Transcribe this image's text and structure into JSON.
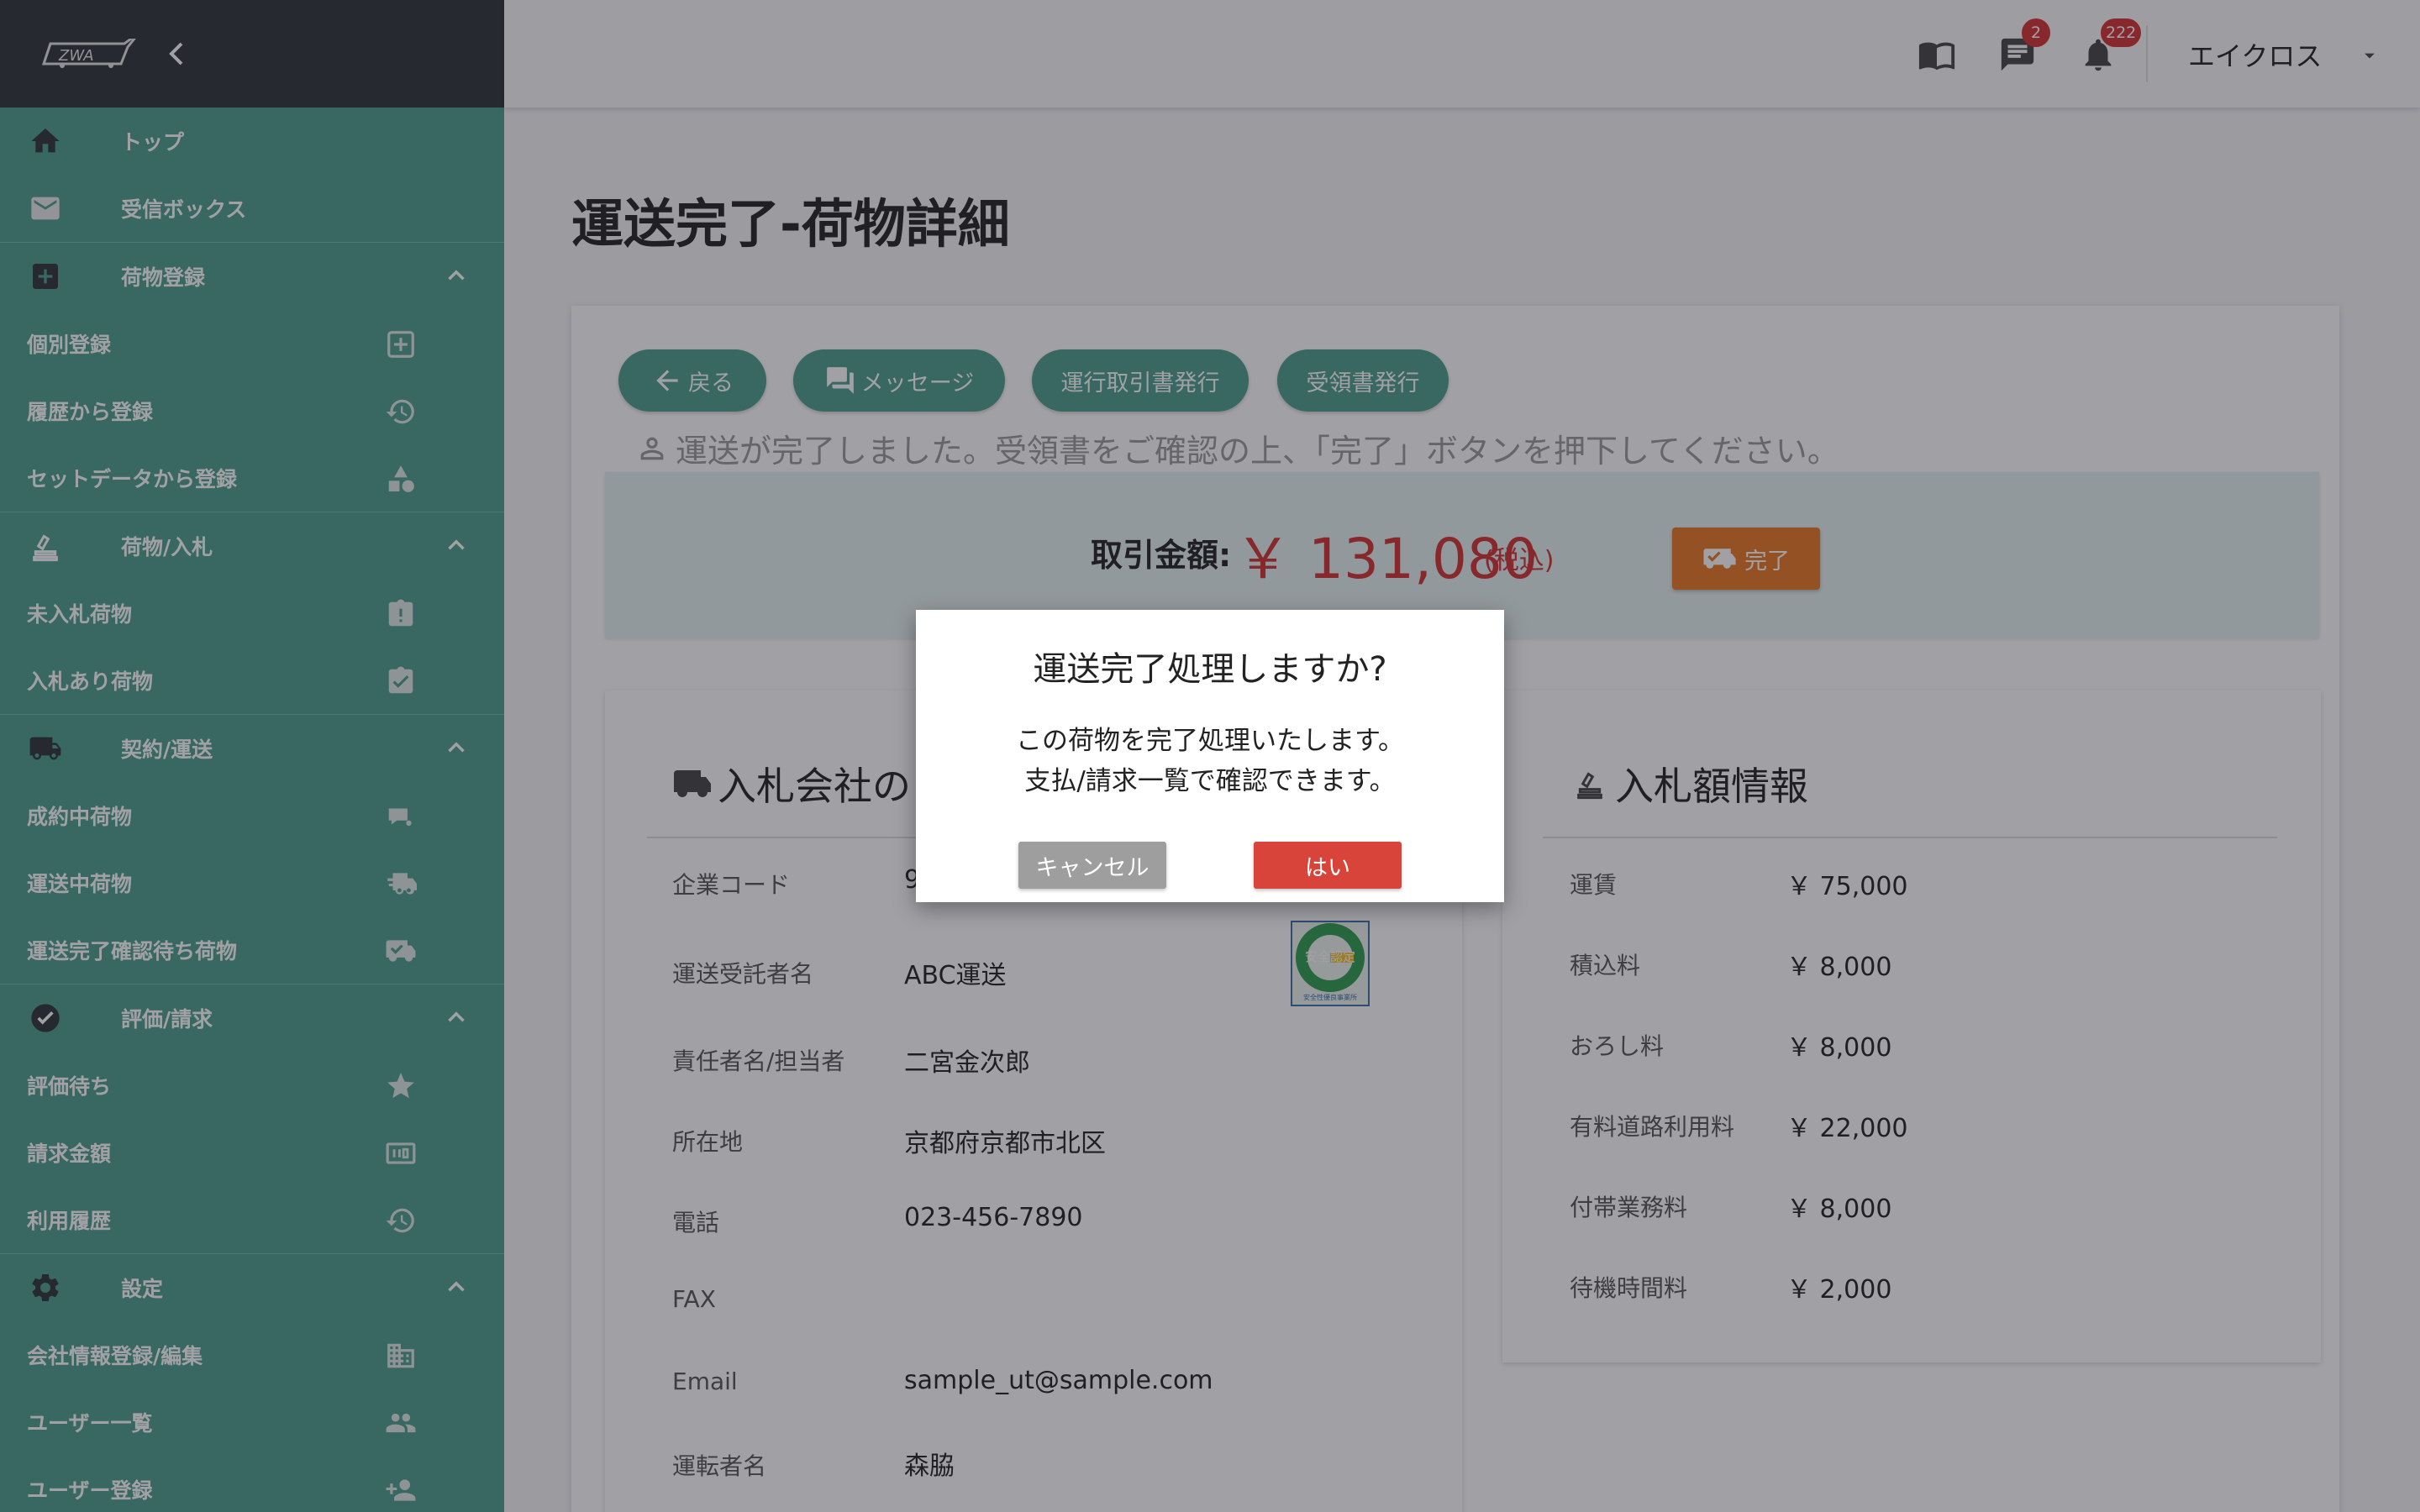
{
  "app": {
    "logo_icon": "truck-logo-icon"
  },
  "colors": {
    "sidebar": "#4a9e8a",
    "sidebar_header": "#2b3135",
    "accent": "#4a9e8a",
    "danger": "#d32f2f",
    "complete": "#e87722"
  },
  "sidebar": {
    "top": {
      "label": "トップ",
      "icon": "home-icon"
    },
    "inbox": {
      "label": "受信ボックス",
      "icon": "mail-icon"
    },
    "group1": {
      "label": "荷物登録",
      "icon": "plus-box-icon"
    },
    "reg_single": {
      "label": "個別登録",
      "icon": "add-box-icon"
    },
    "reg_history": {
      "label": "履歴から登録",
      "icon": "history-icon"
    },
    "reg_set": {
      "label": "セットデータから登録",
      "icon": "shapes-icon"
    },
    "group2": {
      "label": "荷物/入札",
      "icon": "bid-icon"
    },
    "unbid": {
      "label": "未入札荷物",
      "icon": "clipboard-alert-icon"
    },
    "bid": {
      "label": "入札あり荷物",
      "icon": "clipboard-check-icon"
    },
    "group3": {
      "label": "契約/運送",
      "icon": "truck-icon"
    },
    "contracted": {
      "label": "成約中荷物",
      "icon": "small-truck-icon"
    },
    "shipping": {
      "label": "運送中荷物",
      "icon": "truck-fast-icon"
    },
    "awaiting": {
      "label": "運送完了確認待ち荷物",
      "icon": "truck-check-icon"
    },
    "group4": {
      "label": "評価/請求",
      "icon": "check-circle-icon"
    },
    "rating": {
      "label": "評価待ち",
      "icon": "star-icon"
    },
    "billing": {
      "label": "請求金額",
      "icon": "counter-icon"
    },
    "usage": {
      "label": "利用履歴",
      "icon": "history-icon"
    },
    "group5": {
      "label": "設定",
      "icon": "gear-icon"
    },
    "company": {
      "label": "会社情報登録/編集",
      "icon": "building-icon"
    },
    "users": {
      "label": "ユーザー一覧",
      "icon": "users-icon"
    },
    "user_reg": {
      "label": "ユーザー登録",
      "icon": "user-add-icon"
    }
  },
  "topbar": {
    "messages_badge": "2",
    "notifications_badge": "222",
    "user_name": "エイクロス"
  },
  "page": {
    "title": "運送完了-荷物詳細",
    "buttons": {
      "back": "戻る",
      "message": "メッセージ",
      "trade_doc": "運行取引書発行",
      "receipt": "受領書発行"
    },
    "notice": "運送が完了しました。受領書をご確認の上、「完了」ボタンを押下してください。",
    "price_label": "取引金額:",
    "price_value": "￥ 131,080",
    "price_tax": "(税込)",
    "complete_label": "完了"
  },
  "company_card": {
    "title": "入札会社の",
    "rows": [
      {
        "label": "企業コード",
        "value": "9"
      },
      {
        "label": "運送受託者名",
        "value": "ABC運送"
      },
      {
        "label": "責任者名/担当者",
        "value": "二宮金次郎"
      },
      {
        "label": "所在地",
        "value": "京都府京都市北区"
      },
      {
        "label": "電話",
        "value": "023-456-7890"
      },
      {
        "label": "FAX",
        "value": ""
      },
      {
        "label": "Email",
        "value": "sample_ut@sample.com"
      },
      {
        "label": "運転者名",
        "value": "森脇"
      }
    ],
    "seal_text_top": "安全認定",
    "seal_text_bottom": "安全性優良事業所"
  },
  "bid_card": {
    "title": "入札額情報",
    "rows": [
      {
        "label": "運賃",
        "value": "￥ 75,000"
      },
      {
        "label": "積込料",
        "value": "￥ 8,000"
      },
      {
        "label": "おろし料",
        "value": "￥ 8,000"
      },
      {
        "label": "有料道路利用料",
        "value": "￥ 22,000"
      },
      {
        "label": "付帯業務料",
        "value": "￥ 8,000"
      },
      {
        "label": "待機時間料",
        "value": "￥ 2,000"
      }
    ]
  },
  "dialog": {
    "title": "運送完了処理しますか?",
    "line1": "この荷物を完了処理いたします。",
    "line2": "支払/請求一覧で確認できます。",
    "cancel": "キャンセル",
    "ok": "はい"
  }
}
